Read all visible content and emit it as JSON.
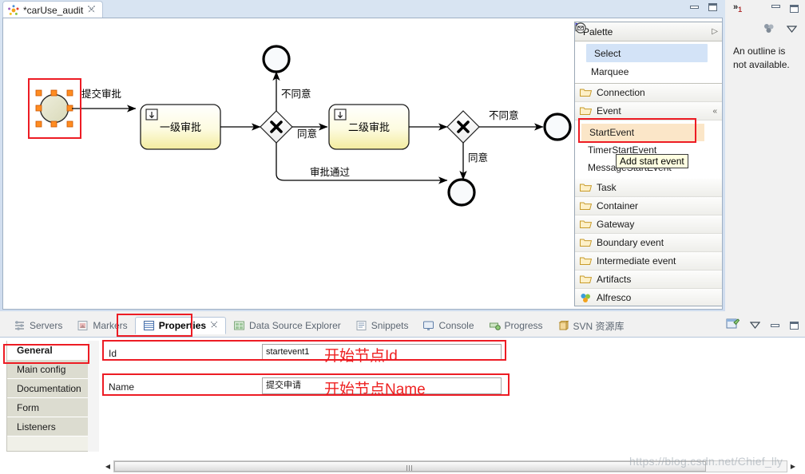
{
  "window": {
    "editor_tab": {
      "title": "*carUse_audit",
      "close_glyph": "✄",
      "icon": "activiti-diagram-icon"
    },
    "minimize_label": "Minimize",
    "maximize_label": "Maximize"
  },
  "diagram": {
    "nodes": [
      {
        "id": "startevent1",
        "type": "start-event",
        "label": "",
        "selected": true
      },
      {
        "id": "usertask1",
        "type": "user-task",
        "label": "一级审批"
      },
      {
        "id": "exclusivegateway1",
        "type": "exclusive-gateway",
        "label": ""
      },
      {
        "id": "usertask2",
        "type": "user-task",
        "label": "二级审批"
      },
      {
        "id": "exclusivegateway2",
        "type": "exclusive-gateway",
        "label": ""
      },
      {
        "id": "endevent1",
        "type": "end-event",
        "label": ""
      },
      {
        "id": "endevent2",
        "type": "end-event",
        "label": ""
      },
      {
        "id": "endevent3",
        "type": "end-event",
        "label": ""
      }
    ],
    "flow_labels": {
      "submit_approval": "提交审批",
      "reject_1": "不同意",
      "agree_1": "同意",
      "reject_2": "不同意",
      "agree_2": "同意",
      "approved": "审批通过"
    }
  },
  "palette": {
    "title": "Palette",
    "expand_glyph": "▷",
    "tools": [
      {
        "label": "Select",
        "icon": "cursor-icon",
        "selected": true
      },
      {
        "label": "Marquee",
        "icon": "marquee-icon",
        "selected": false
      }
    ],
    "groups": [
      {
        "label": "Connection",
        "icon": "folder-icon"
      },
      {
        "label": "Event",
        "icon": "folder-icon",
        "collapse_glyph": "«"
      }
    ],
    "events": [
      {
        "label": "StartEvent",
        "icon": "start-event-icon",
        "highlighted": true
      },
      {
        "label": "TimerStartEvent",
        "icon": "timer-start-event-icon",
        "highlighted": false
      },
      {
        "label": "MessageStartEvent",
        "icon": "message-start-event-icon",
        "highlighted": false
      }
    ],
    "groups_after": [
      {
        "label": "Task",
        "icon": "folder-icon"
      },
      {
        "label": "Container",
        "icon": "folder-icon"
      },
      {
        "label": "Gateway",
        "icon": "folder-icon"
      },
      {
        "label": "Boundary event",
        "icon": "folder-icon"
      },
      {
        "label": "Intermediate event",
        "icon": "folder-icon"
      },
      {
        "label": "Artifacts",
        "icon": "folder-icon"
      },
      {
        "label": "Alfresco",
        "icon": "alfresco-icon"
      }
    ],
    "tooltip": "Add start event"
  },
  "outline": {
    "chevron": "»",
    "count": "1",
    "message_line1": "An outline is",
    "message_line2": "not available."
  },
  "bottom_tabs": [
    {
      "label": "Servers",
      "icon": "servers-icon",
      "active": false
    },
    {
      "label": "Markers",
      "icon": "markers-icon",
      "active": false
    },
    {
      "label": "Properties",
      "icon": "properties-icon",
      "active": true,
      "close_glyph": "✄"
    },
    {
      "label": "Data Source Explorer",
      "icon": "data-source-icon",
      "active": false
    },
    {
      "label": "Snippets",
      "icon": "snippets-icon",
      "active": false
    },
    {
      "label": "Console",
      "icon": "console-icon",
      "active": false
    },
    {
      "label": "Progress",
      "icon": "progress-icon",
      "active": false
    },
    {
      "label": "SVN 资源库",
      "icon": "svn-icon",
      "active": false
    }
  ],
  "properties": {
    "tabs": [
      {
        "label": "General",
        "active": true
      },
      {
        "label": "Main config",
        "active": false
      },
      {
        "label": "Documentation",
        "active": false
      },
      {
        "label": "Form",
        "active": false
      },
      {
        "label": "Listeners",
        "active": false
      }
    ],
    "fields": [
      {
        "label": "Id",
        "value": "startevent1",
        "annotation": "开始节点Id"
      },
      {
        "label": "Name",
        "value": "提交申请",
        "annotation": "开始节点Name"
      }
    ]
  },
  "watermark": "https://blog.csdn.net/Chief_lly",
  "colors": {
    "accent_red": "#ed1c24",
    "selected_blue": "#d3e3f7",
    "highlight_orange": "#fbe6c8",
    "task_yellow": "#f5efa8",
    "tooltip_bg": "#ffffe1"
  }
}
